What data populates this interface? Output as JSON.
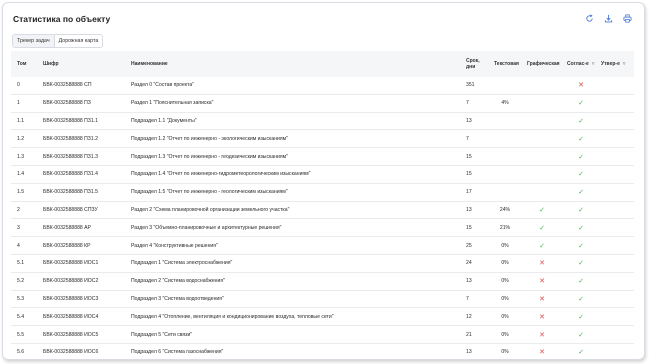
{
  "title": "Статистика по объекту",
  "tabs": [
    "Трекер задач",
    "Дорожная карта"
  ],
  "header_icons": [
    "refresh-icon",
    "download-icon",
    "print-icon"
  ],
  "columns": {
    "tom": "Том",
    "code": "Шифр",
    "name": "Наименование",
    "days": "Срок, дни",
    "text": "Текстовая",
    "graph": "Графическая",
    "sogl": "Соглас-е",
    "utv": "Утвер-е"
  },
  "colors": {
    "ok": "#45b649",
    "no": "#e04b4b"
  },
  "rows": [
    {
      "tom": "0",
      "code": "БВК-0032588888 СП",
      "name": "Раздел 0 \"Состав проекта\"",
      "days": "351",
      "text": "",
      "graph": "",
      "sogl": "no",
      "utv": ""
    },
    {
      "tom": "1",
      "code": "БВК-0032588888 ПЗ",
      "name": "Раздел 1 \"Пояснительная записка\"",
      "days": "7",
      "text": "4%",
      "graph": "",
      "sogl": "ok",
      "utv": ""
    },
    {
      "tom": "1.1",
      "code": "БВК-0032588888 ПЗ1.1",
      "name": "Подраздел 1.1 \"Документы\"",
      "days": "13",
      "text": "",
      "graph": "",
      "sogl": "ok",
      "utv": ""
    },
    {
      "tom": "1.2",
      "code": "БВК-0032588888 ПЗ1.2",
      "name": "Подраздел 1.2 \"Отчет по инженерно - экологическим изысканиям\"",
      "days": "7",
      "text": "",
      "graph": "",
      "sogl": "ok",
      "utv": ""
    },
    {
      "tom": "1.3",
      "code": "БВК-0032588888 ПЗ1.3",
      "name": "Подраздел 1.3 \"Отчет по инженерно - геодезическим изысканиям\"",
      "days": "15",
      "text": "",
      "graph": "",
      "sogl": "ok",
      "utv": ""
    },
    {
      "tom": "1.4",
      "code": "БВК-0032588888 ПЗ1.4",
      "name": "Подраздел 1.4 \"Отчет по инженерно-гидрометеорологическим изысканиям\"",
      "days": "15",
      "text": "",
      "graph": "",
      "sogl": "ok",
      "utv": ""
    },
    {
      "tom": "1.5",
      "code": "БВК-0032588888 ПЗ1.5",
      "name": "Подраздел 1.5 \"Отчет по инженерно - геологическим изысканиям\"",
      "days": "17",
      "text": "",
      "graph": "",
      "sogl": "ok",
      "utv": ""
    },
    {
      "tom": "2",
      "code": "БВК-0032588888 СПЗУ",
      "name": "Раздел 2 \"Схема планировочной организации земельного участка\"",
      "days": "13",
      "text": "24%",
      "graph": "ok",
      "sogl": "ok",
      "utv": ""
    },
    {
      "tom": "3",
      "code": "БВК-0032588888 АР",
      "name": "Раздел 3 \"Объемно-планировочные и архитектурные решения\"",
      "days": "15",
      "text": "21%",
      "graph": "ok",
      "sogl": "ok",
      "utv": ""
    },
    {
      "tom": "4",
      "code": "БВК-0032588888 КР",
      "name": "Раздел 4 \"Конструктивные решения\"",
      "days": "25",
      "text": "0%",
      "graph": "ok",
      "sogl": "ok",
      "utv": ""
    },
    {
      "tom": "5.1",
      "code": "БВК-0032588888 ИОС1",
      "name": "Подраздел 1 \"Система электроснабжения\"",
      "days": "24",
      "text": "0%",
      "graph": "no",
      "sogl": "ok",
      "utv": ""
    },
    {
      "tom": "5.2",
      "code": "БВК-0032588888 ИОС2",
      "name": "Подраздел 2 \"Система водоснабжения\"",
      "days": "13",
      "text": "0%",
      "graph": "no",
      "sogl": "ok",
      "utv": ""
    },
    {
      "tom": "5.3",
      "code": "БВК-0032588888 ИОС3",
      "name": "Подраздел 3 \"Система водоотведения\"",
      "days": "7",
      "text": "0%",
      "graph": "no",
      "sogl": "ok",
      "utv": ""
    },
    {
      "tom": "5.4",
      "code": "БВК-0032588888 ИОС4",
      "name": "Подраздел 4 \"Отопление, вентиляция и кондиционирование воздуха, тепловые сети\"",
      "days": "12",
      "text": "0%",
      "graph": "no",
      "sogl": "ok",
      "utv": ""
    },
    {
      "tom": "5.5",
      "code": "БВК-0032588888 ИОС5",
      "name": "Подраздел 5 \"Сети связи\"",
      "days": "21",
      "text": "0%",
      "graph": "no",
      "sogl": "ok",
      "utv": ""
    },
    {
      "tom": "5.6",
      "code": "БВК-0032588888 ИОС6",
      "name": "Подраздел 6 \"Система газоснабжения\"",
      "days": "13",
      "text": "0%",
      "graph": "no",
      "sogl": "ok",
      "utv": ""
    },
    {
      "tom": "6",
      "code": "БВК-0032588888 ТХ",
      "name": "Раздел 6 \"Технологические решения\"",
      "days": "23",
      "text": "0%",
      "graph": "no",
      "sogl": "ok",
      "utv": ""
    }
  ]
}
